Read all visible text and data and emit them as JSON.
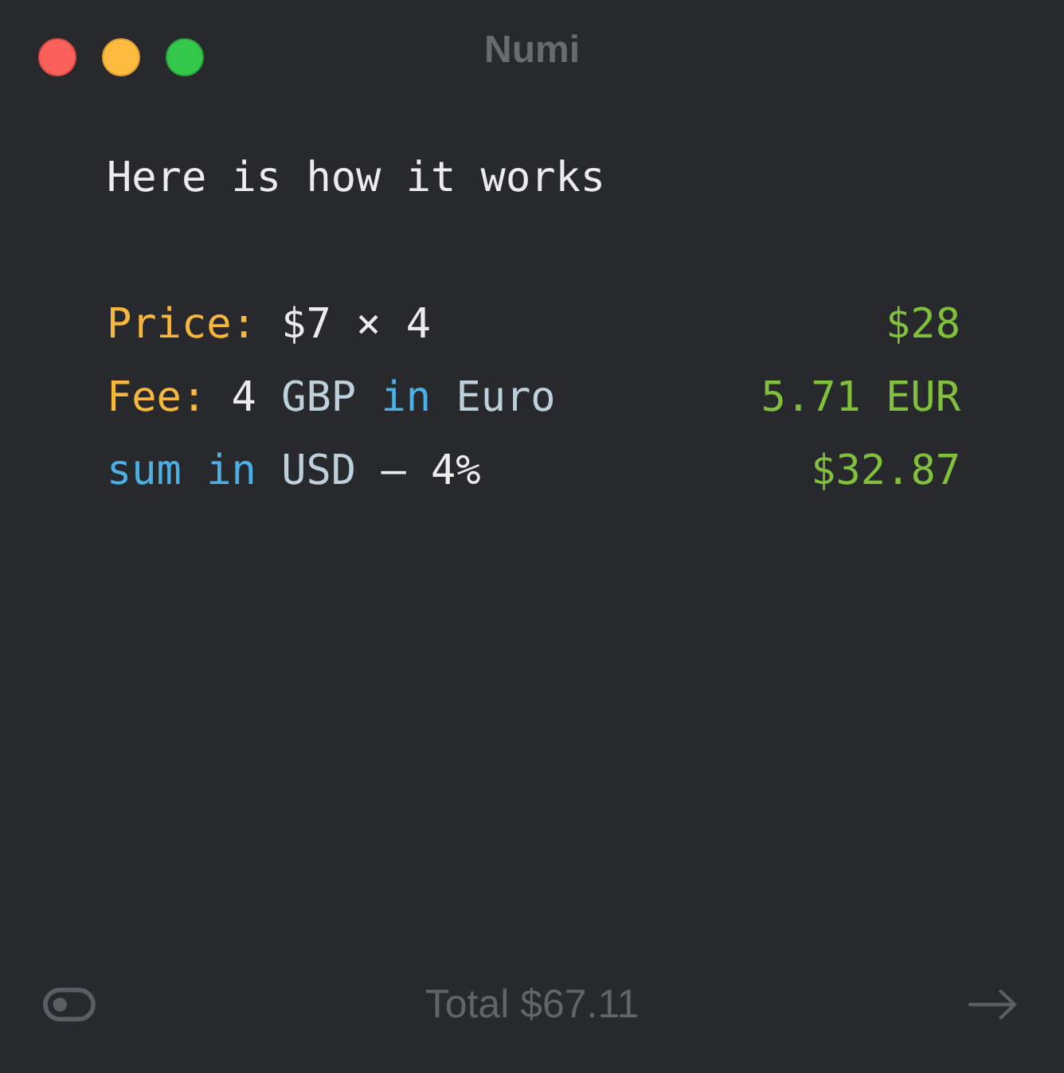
{
  "window": {
    "title": "Numi"
  },
  "heading": "Here is how it works",
  "lines": [
    {
      "tokens": [
        {
          "text": "Price:",
          "kind": "label"
        },
        {
          "text": "$7 × 4",
          "kind": "number"
        }
      ],
      "result": "$28"
    },
    {
      "tokens": [
        {
          "text": "Fee:",
          "kind": "label"
        },
        {
          "text": "4",
          "kind": "number"
        },
        {
          "text": "GBP",
          "kind": "unit"
        },
        {
          "text": "in",
          "kind": "keyword"
        },
        {
          "text": "Euro",
          "kind": "unit"
        }
      ],
      "result": "5.71 EUR"
    },
    {
      "tokens": [
        {
          "text": "sum",
          "kind": "keyword"
        },
        {
          "text": "in",
          "kind": "keyword"
        },
        {
          "text": "USD",
          "kind": "unit"
        },
        {
          "text": "– 4%",
          "kind": "number"
        }
      ],
      "result": "$32.87"
    }
  ],
  "footer": {
    "total": "Total $67.11"
  }
}
